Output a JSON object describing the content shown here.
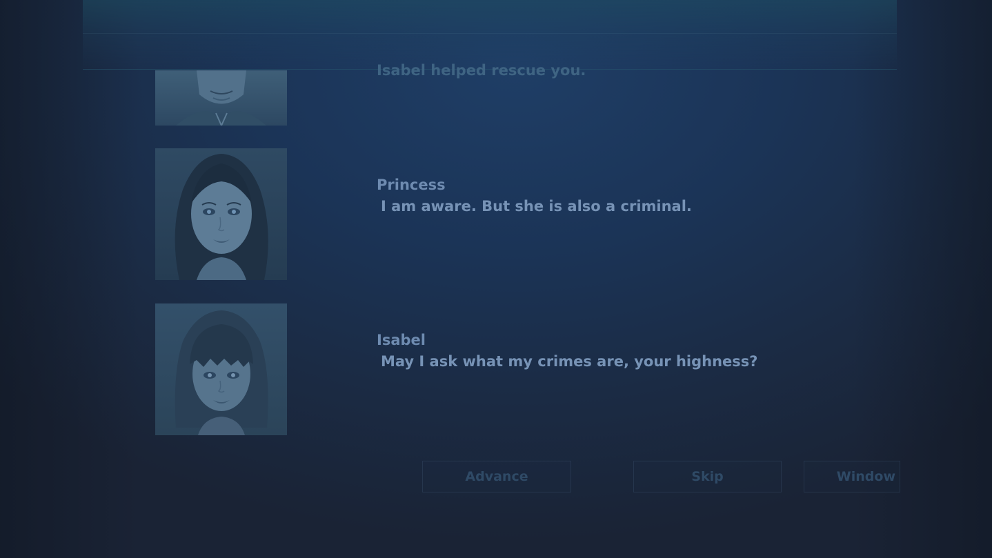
{
  "dialogue": {
    "previous_line": "Isabel helped rescue you.",
    "entries": [
      {
        "speaker": "Princess",
        "text": " I am aware. But she is also a criminal."
      },
      {
        "speaker": "Isabel",
        "text": " May I ask what my crimes are, your highness?"
      }
    ]
  },
  "controls": {
    "advance_label": "Advance",
    "skip_label": "Skip",
    "window_label": "Window"
  }
}
